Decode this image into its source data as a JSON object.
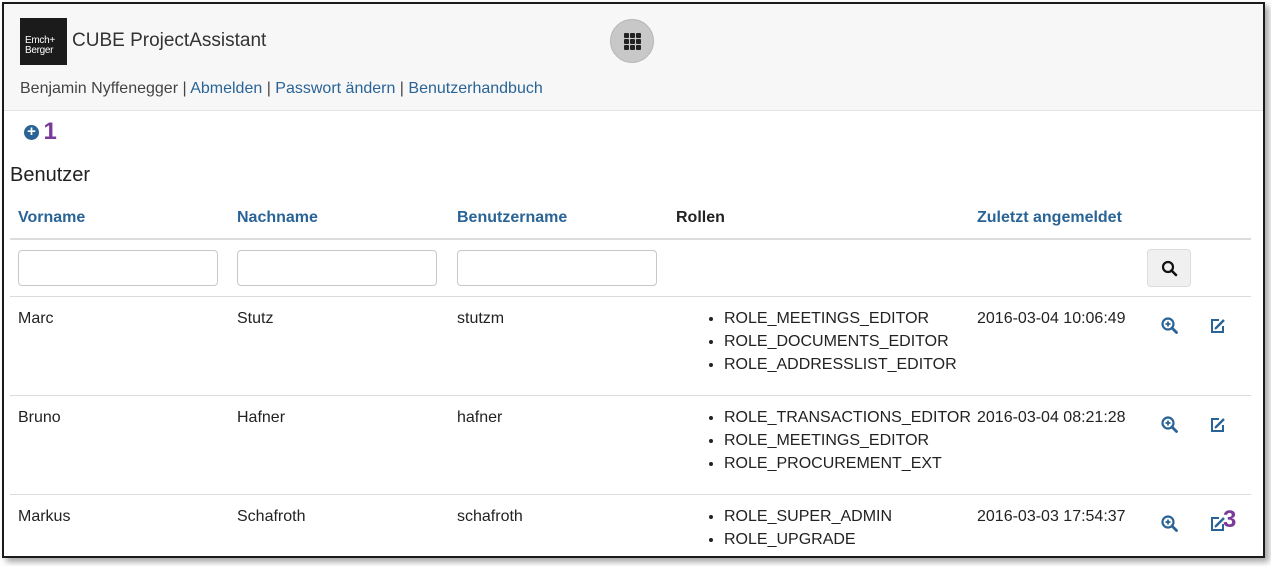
{
  "app": {
    "logo_text": "Emch+ Berger",
    "title": "CUBE ProjectAssistant"
  },
  "userbar": {
    "user": "Benjamin Nyffenegger",
    "separator": " | ",
    "logout": "Abmelden",
    "change_password": "Passwort ändern",
    "manual": "Benutzerhandbuch"
  },
  "annotations": {
    "add": "1",
    "edit": "3"
  },
  "section_title": "Benutzer",
  "table": {
    "columns": [
      "Vorname",
      "Nachname",
      "Benutzername",
      "Rollen",
      "Zuletzt angemeldet"
    ],
    "rows": [
      {
        "vorname": "Marc",
        "nachname": "Stutz",
        "benutzername": "stutzm",
        "rollen": [
          "ROLE_MEETINGS_EDITOR",
          "ROLE_DOCUMENTS_EDITOR",
          "ROLE_ADDRESSLIST_EDITOR"
        ],
        "zuletzt": "2016-03-04 10:06:49"
      },
      {
        "vorname": "Bruno",
        "nachname": "Hafner",
        "benutzername": "hafner",
        "rollen": [
          "ROLE_TRANSACTIONS_EDITOR",
          "ROLE_MEETINGS_EDITOR",
          "ROLE_PROCUREMENT_EXT"
        ],
        "zuletzt": "2016-03-04 08:21:28"
      },
      {
        "vorname": "Markus",
        "nachname": "Schafroth",
        "benutzername": "schafroth",
        "rollen": [
          "ROLE_SUPER_ADMIN",
          "ROLE_UPGRADE"
        ],
        "zuletzt": "2016-03-03 17:54:37"
      }
    ]
  },
  "icons": {
    "apps": "grid-icon",
    "add": "plus-circle-icon",
    "search": "search-icon",
    "view": "zoom-in-icon",
    "edit": "edit-icon"
  },
  "colors": {
    "link": "#2a6496",
    "annotation": "#7a3a9a"
  }
}
